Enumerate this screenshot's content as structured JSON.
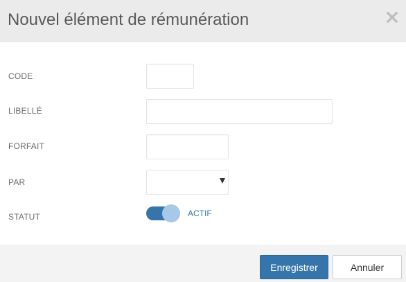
{
  "dialog": {
    "title": "Nouvel élément de rémunération",
    "close_icon": "close-icon"
  },
  "form": {
    "code": {
      "label": "CODE",
      "value": ""
    },
    "libelle": {
      "label": "LIBELLÉ",
      "value": ""
    },
    "forfait": {
      "label": "FORFAIT",
      "value": ""
    },
    "par": {
      "label": "PAR",
      "selected": ""
    },
    "statut": {
      "label": "STATUT",
      "toggle_label": "ACTIF",
      "on": true
    }
  },
  "footer": {
    "save_label": "Enregistrer",
    "cancel_label": "Annuler"
  },
  "colors": {
    "header_bg": "#ebebeb",
    "footer_bg": "#f3f3f3",
    "accent": "#3575ac",
    "toggle_knob": "#a8c8e8"
  }
}
